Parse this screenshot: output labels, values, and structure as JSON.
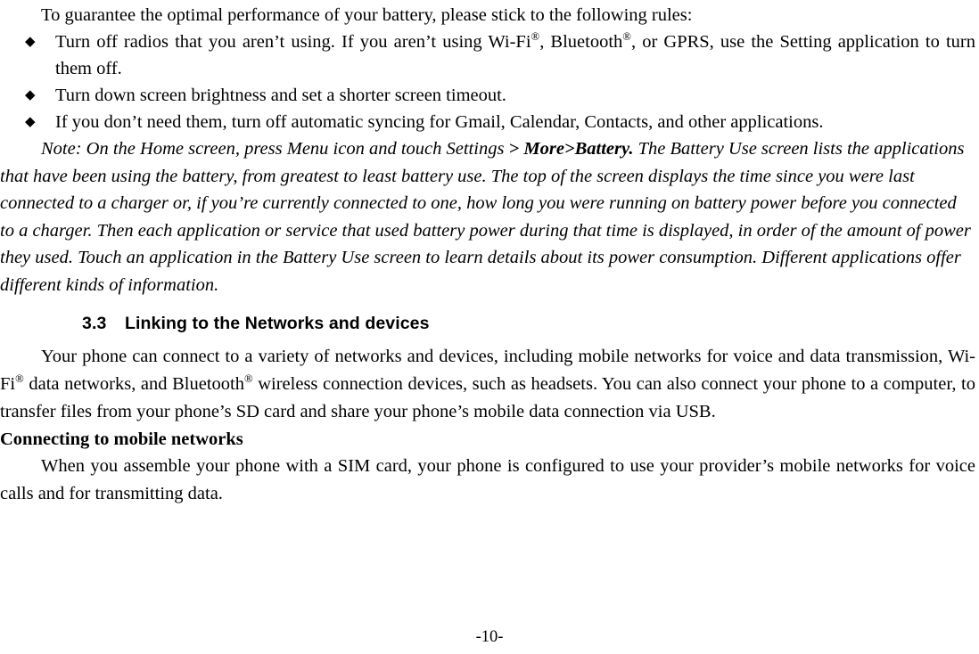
{
  "document": {
    "intro_line": "To guarantee the optimal performance of your battery, please stick to the following rules:",
    "bullets": [
      {
        "mark": "◆",
        "text_before_sup1": "Turn off radios that you aren’t using. If you aren’t using Wi-Fi",
        "sup1": "®",
        "text_mid": ", Bluetooth",
        "sup2": "®",
        "text_after": ", or GPRS, use the Setting application to turn them off."
      },
      {
        "mark": "◆",
        "text": "Turn down screen brightness and set a shorter screen timeout."
      },
      {
        "mark": "◆",
        "text": "If you don’t need them, turn off automatic syncing for Gmail, Calendar, Contacts, and other applications."
      }
    ],
    "note": {
      "lead_italic": "Note: On the Home screen, press Menu icon and touch Settings ",
      "bold_italic": ">",
      "mid_italic": " ",
      "bold_italic2": "More>Battery.",
      "rest": " The Battery Use screen lists the applications that have been using the battery, from greatest to least battery use. The top of the screen displays the time since you were last connected to a charger or, if you’re currently connected to one, how long you were running on battery power before you connected to a charger. Then each application or service that used battery power during that time is displayed, in order of the amount of power they used. Touch an application in the Battery Use screen to learn details about its power consumption. Different applications offer different kinds of information."
    },
    "section": {
      "number": "3.3",
      "title": "Linking to the Networks and devices"
    },
    "paragraph_1": {
      "part1": "Your phone can connect to a variety of networks and devices, including mobile networks for voice and data transmission, Wi-Fi",
      "sup1": "®",
      "part2": " data networks, and Bluetooth",
      "sup2": "®",
      "part3": " wireless connection devices, such as headsets. You can also connect your phone to a computer, to transfer files from your phone’s SD card and share your phone’s mobile data connection via USB."
    },
    "subheading": "Connecting to mobile networks",
    "paragraph_2": "When you assemble your phone with a SIM card, your phone is configured to use your provider’s mobile networks for voice calls and for transmitting data.",
    "footer": "-10-"
  }
}
